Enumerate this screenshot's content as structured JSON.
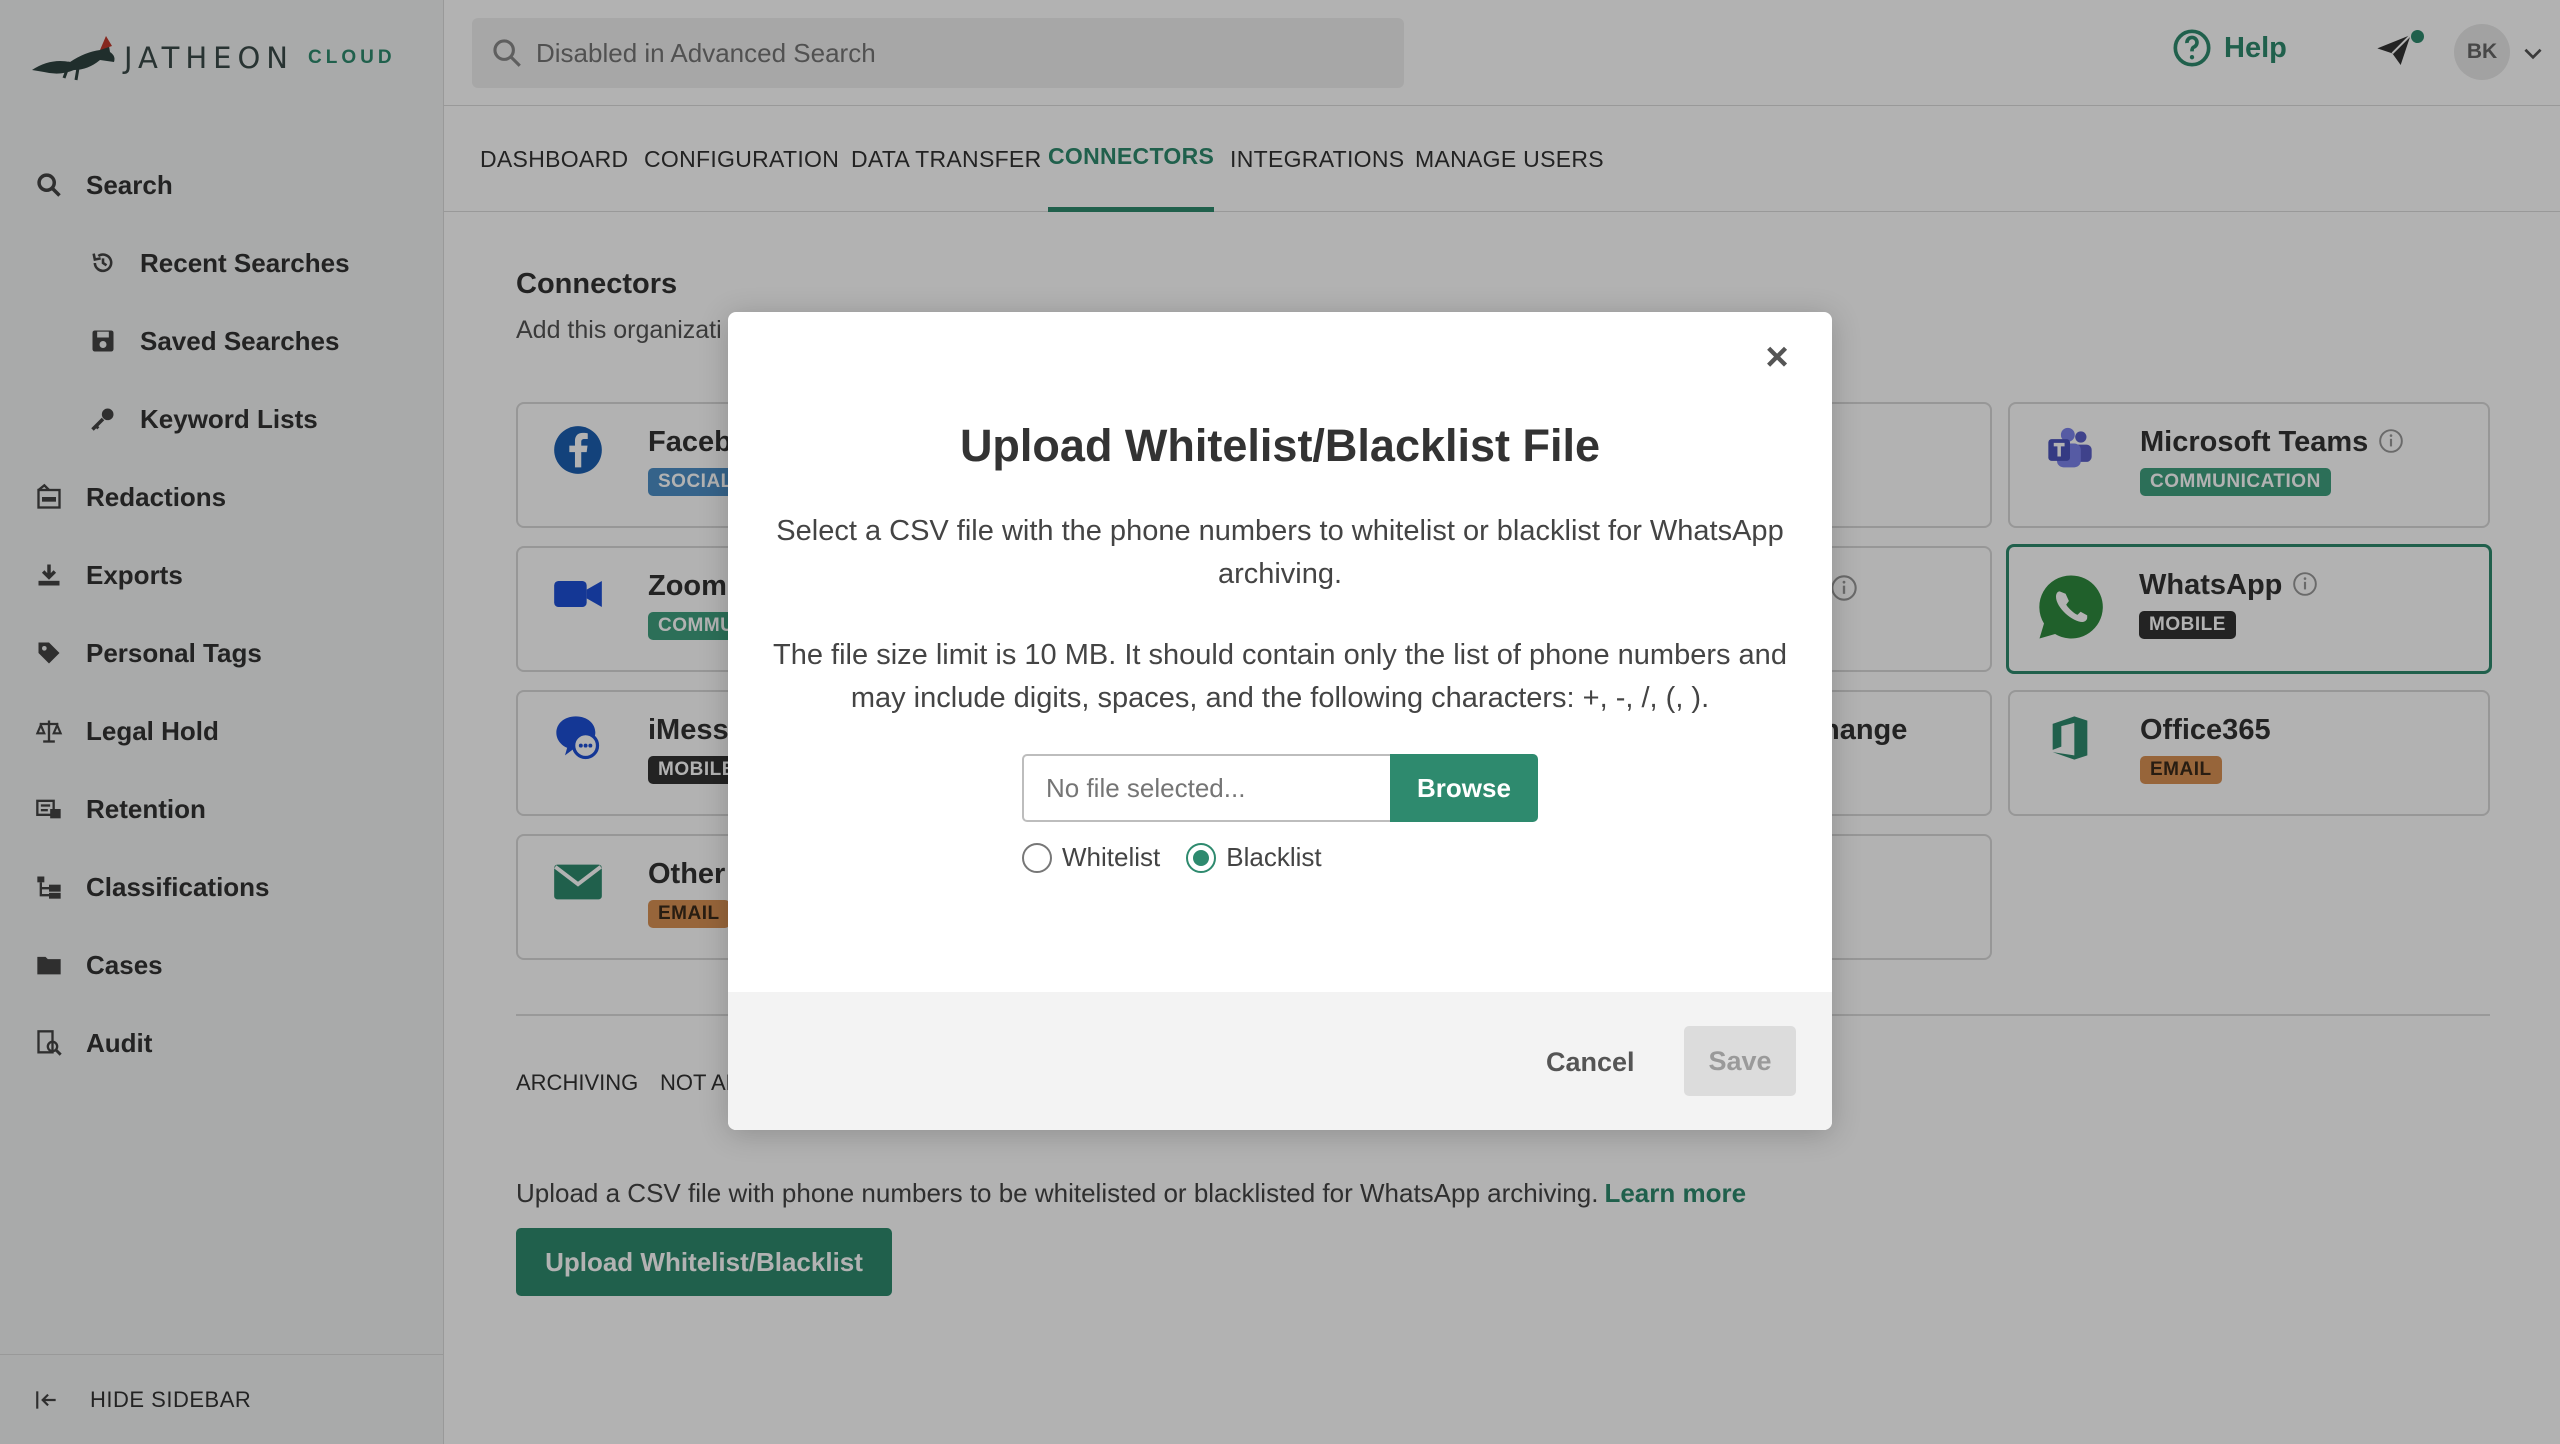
{
  "app": {
    "brand": "JATHEON",
    "cloud": "CLOUD"
  },
  "sidebar": {
    "items": [
      {
        "label": "Search",
        "icon": "search-icon"
      },
      {
        "label": "Recent Searches",
        "icon": "history-icon"
      },
      {
        "label": "Saved Searches",
        "icon": "save-icon"
      },
      {
        "label": "Keyword Lists",
        "icon": "key-icon"
      },
      {
        "label": "Redactions",
        "icon": "redaction-icon"
      },
      {
        "label": "Exports",
        "icon": "download-icon"
      },
      {
        "label": "Personal Tags",
        "icon": "tag-icon"
      },
      {
        "label": "Legal Hold",
        "icon": "scale-icon"
      },
      {
        "label": "Retention",
        "icon": "retention-icon"
      },
      {
        "label": "Classifications",
        "icon": "hierarchy-icon"
      },
      {
        "label": "Cases",
        "icon": "folder-icon"
      },
      {
        "label": "Audit",
        "icon": "audit-icon"
      }
    ],
    "hide_label": "HIDE SIDEBAR"
  },
  "topbar": {
    "search_placeholder": "Disabled in Advanced Search",
    "help_label": "Help",
    "avatar_initials": "BK"
  },
  "tabs": [
    {
      "label": "DASHBOARD"
    },
    {
      "label": "CONFIGURATION"
    },
    {
      "label": "DATA TRANSFER"
    },
    {
      "label": "CONNECTORS",
      "active": true
    },
    {
      "label": "INTEGRATIONS"
    },
    {
      "label": "MANAGE USERS"
    }
  ],
  "main": {
    "title": "Connectors",
    "subtitle": "Add this organizati",
    "cards": [
      {
        "name": "Faceb",
        "badge": "SOCIAL"
      },
      {
        "name": "Microsoft Teams",
        "badge": "COMMUNICATION"
      },
      {
        "name": "Zoom",
        "badge": "COMMU"
      },
      {
        "name": "WhatsApp",
        "badge": "MOBILE"
      },
      {
        "name": "iMess",
        "badge": "MOBILE"
      },
      {
        "name": "hange"
      },
      {
        "name": "Office365",
        "badge": "EMAIL"
      },
      {
        "name": "Other",
        "badge": "EMAIL"
      }
    ],
    "subtabs": [
      "ARCHIVING",
      "NOT AR"
    ],
    "upload_text": "Upload a CSV file with phone numbers to be whitelisted or blacklisted for WhatsApp archiving.",
    "learn_more": "Learn more",
    "upload_button": "Upload Whitelist/Blacklist"
  },
  "modal": {
    "title": "Upload Whitelist/Blacklist File",
    "desc1": "Select a CSV file with the phone numbers to whitelist or blacklist for WhatsApp archiving.",
    "desc2": "The file size limit is 10 MB. It should contain only the list of phone numbers and may include digits, spaces, and the following characters: +, -, /, (, ).",
    "file_placeholder": "No file selected...",
    "browse_label": "Browse",
    "radio_whitelist": "Whitelist",
    "radio_blacklist": "Blacklist",
    "selected": "Blacklist",
    "cancel_label": "Cancel",
    "save_label": "Save"
  },
  "colors": {
    "accent": "#2e8a6e",
    "badge_comm": "#3f9f7f",
    "badge_email": "#d99154",
    "badge_social": "#4c8fc6"
  }
}
